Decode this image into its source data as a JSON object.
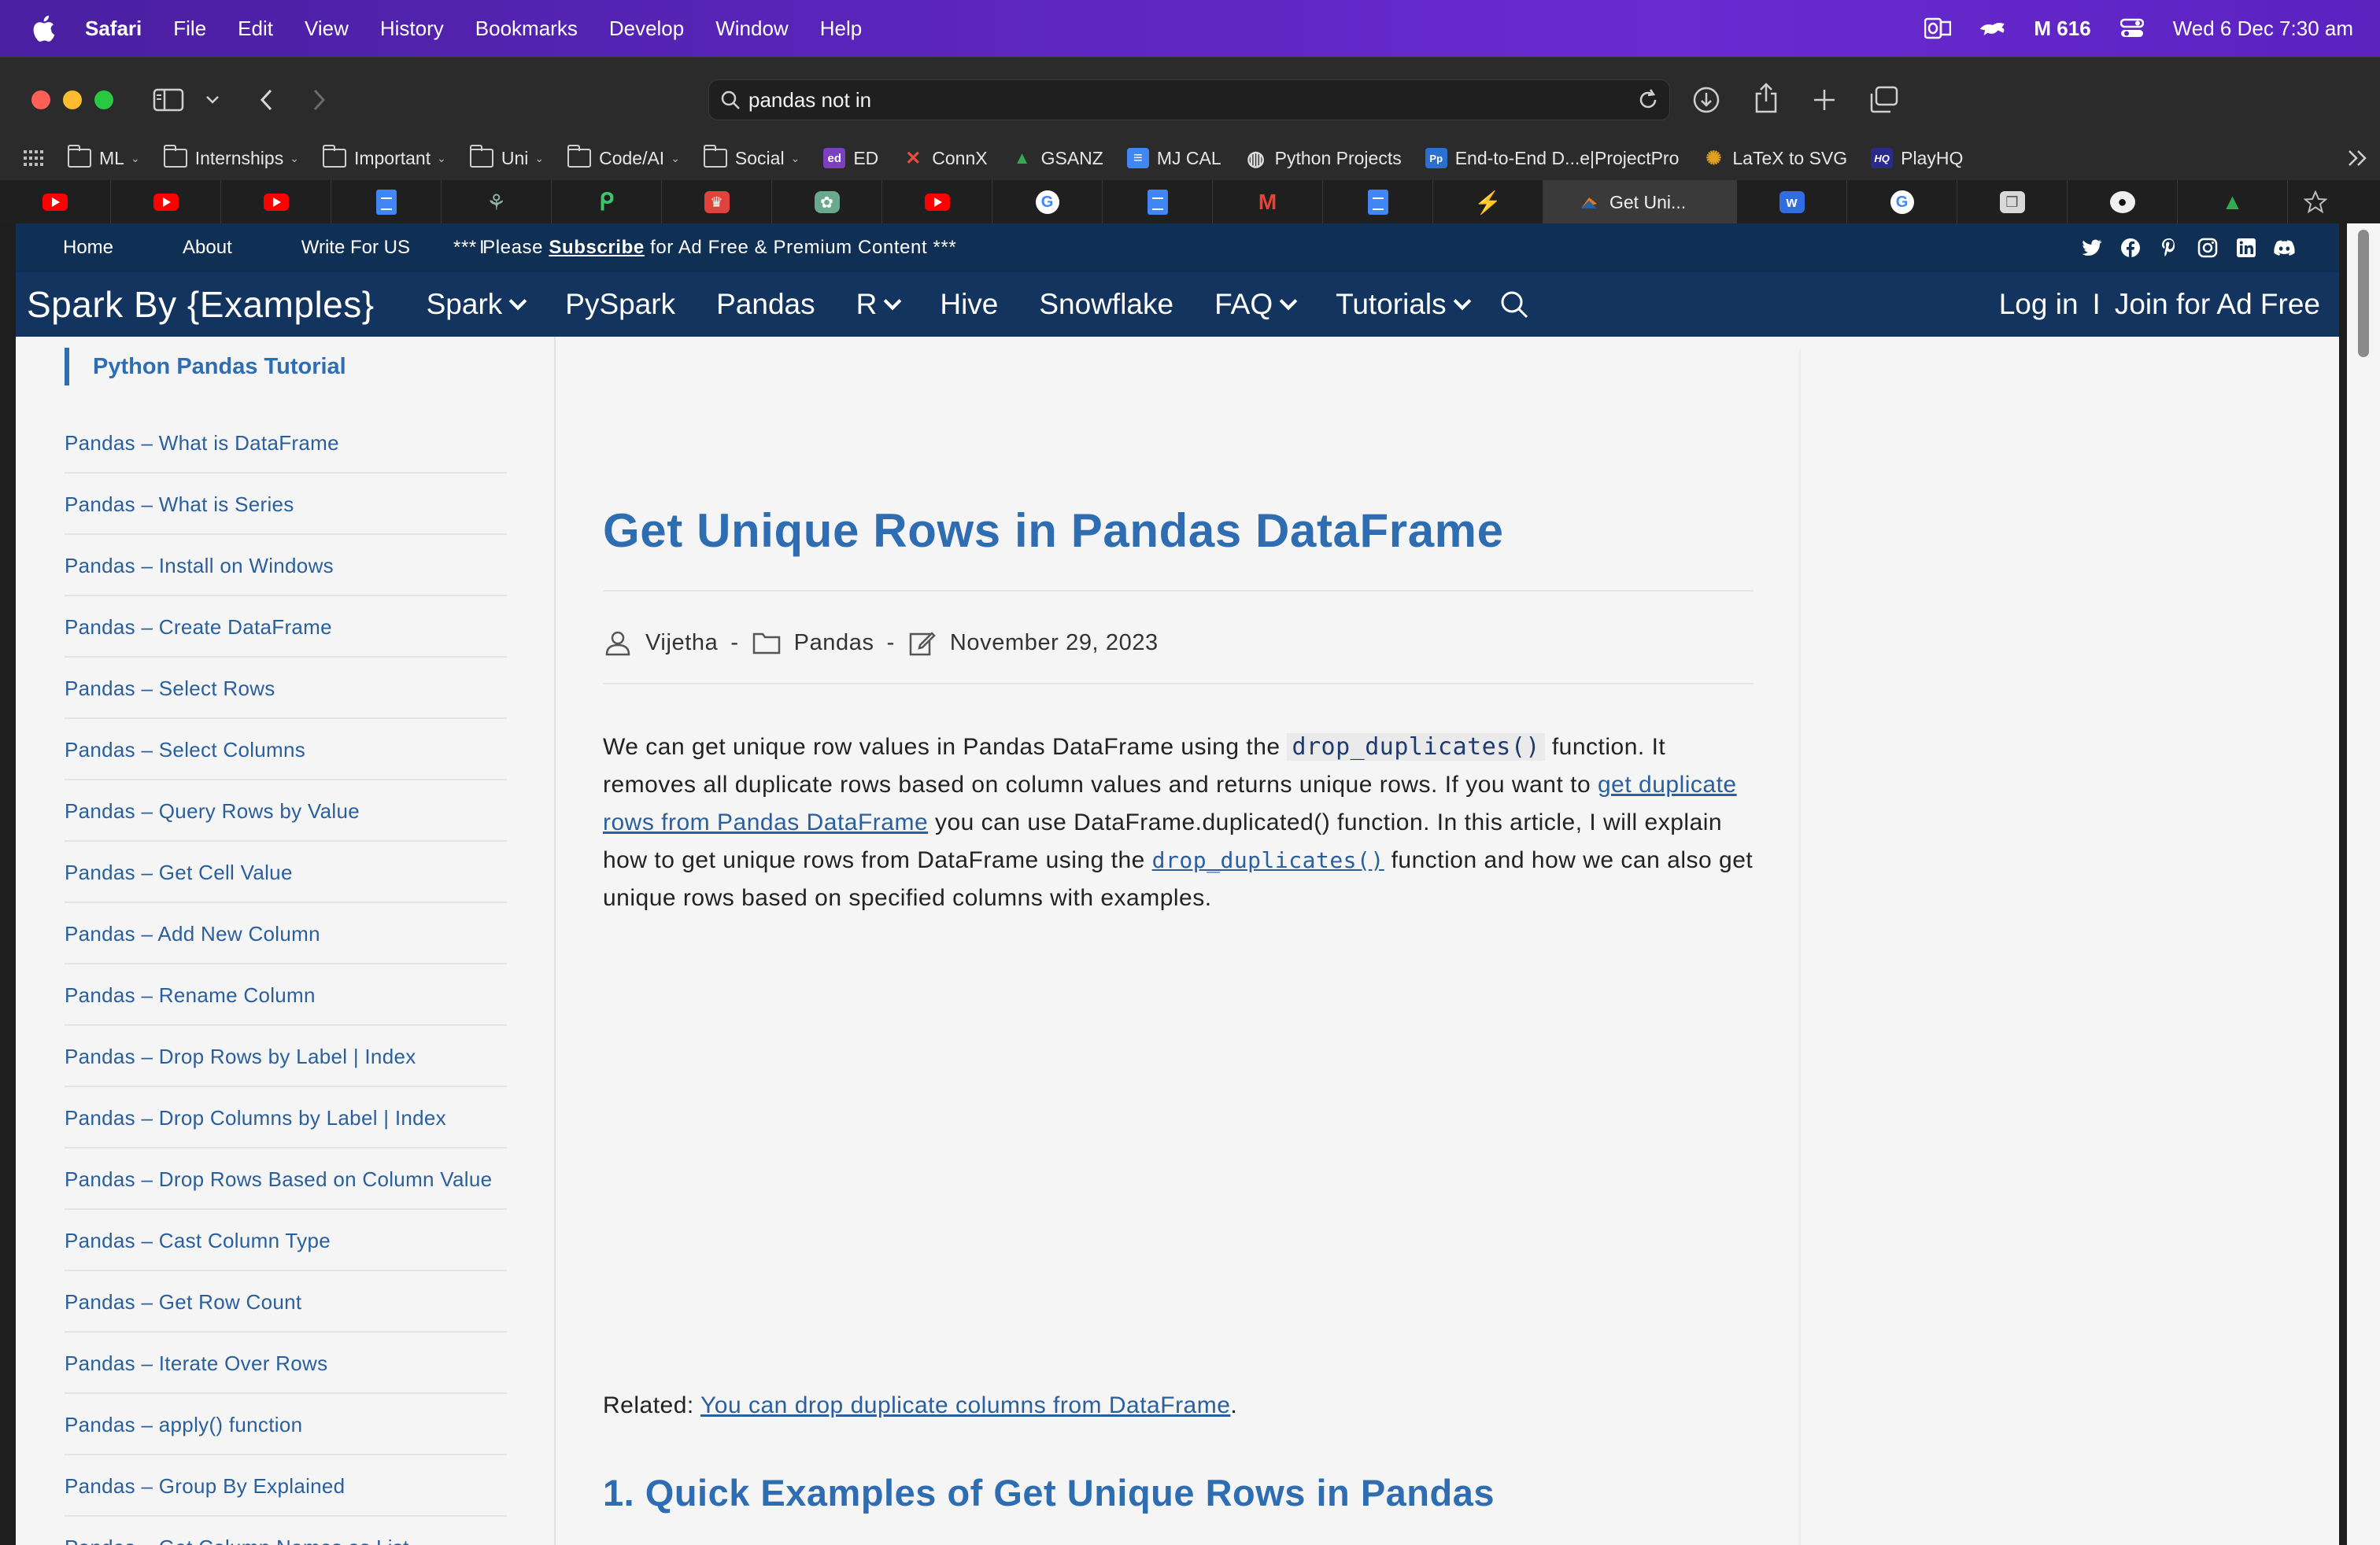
{
  "menubar": {
    "app": "Safari",
    "items": [
      "File",
      "Edit",
      "View",
      "History",
      "Bookmarks",
      "Develop",
      "Window",
      "Help"
    ],
    "status_mail": "M 616",
    "clock": "Wed 6 Dec  7:30 am"
  },
  "browser": {
    "address": "pandas not in",
    "bookmarks": [
      {
        "label": "ML",
        "folder": true
      },
      {
        "label": "Internships",
        "folder": true
      },
      {
        "label": "Important",
        "folder": true
      },
      {
        "label": "Uni",
        "folder": true
      },
      {
        "label": "Code/AI",
        "folder": true
      },
      {
        "label": "Social",
        "folder": true
      },
      {
        "label": "ED",
        "icon_text": "ed",
        "color": "#7b3fbf"
      },
      {
        "label": "ConnX",
        "icon_text": "✕",
        "color": "#c0392b"
      },
      {
        "label": "GSANZ",
        "icon_text": "▲",
        "color": "#34a853"
      },
      {
        "label": "MJ CAL",
        "icon_text": "≡",
        "color": "#4285f4"
      },
      {
        "label": "Python Projects",
        "icon_text": "◍",
        "color": "#666666"
      },
      {
        "label": "End-to-End D...e|ProjectPro",
        "icon_text": "Pp",
        "color": "#2d6fd0"
      },
      {
        "label": "LaTeX to SVG",
        "icon_text": "✺",
        "color": "#e0a020"
      },
      {
        "label": "PlayHQ",
        "icon_text": "HQ",
        "color": "#2a2a8a"
      }
    ],
    "active_tab": "Get Uni..."
  },
  "site": {
    "top_links": [
      "Home",
      "About",
      "Write For US",
      "I"
    ],
    "promo_pre": "*** Please ",
    "promo_link": "Subscribe",
    "promo_post": " for Ad Free & Premium Content ***",
    "brand": "Spark By {Examples}",
    "nav": [
      {
        "label": "Spark",
        "dropdown": true
      },
      {
        "label": "PySpark",
        "dropdown": false
      },
      {
        "label": "Pandas",
        "dropdown": false
      },
      {
        "label": "R",
        "dropdown": true
      },
      {
        "label": "Hive",
        "dropdown": false
      },
      {
        "label": "Snowflake",
        "dropdown": false
      },
      {
        "label": "FAQ",
        "dropdown": true
      },
      {
        "label": "Tutorials",
        "dropdown": true
      }
    ],
    "login": "Log in",
    "auth_sep": "I",
    "join": "Join for Ad Free"
  },
  "sidebar": {
    "title": "Python Pandas Tutorial",
    "items": [
      "Pandas – What is DataFrame",
      "Pandas – What is Series",
      "Pandas – Install on Windows",
      "Pandas – Create DataFrame",
      "Pandas – Select Rows",
      "Pandas – Select Columns",
      "Pandas – Query Rows by Value",
      "Pandas – Get Cell Value",
      "Pandas – Add New Column",
      "Pandas – Rename Column",
      "Pandas – Drop Rows by Label | Index",
      "Pandas – Drop Columns by Label | Index",
      "Pandas – Drop Rows Based on Column Value",
      "Pandas – Cast Column Type",
      "Pandas – Get Row Count",
      "Pandas – Iterate Over Rows",
      "Pandas – apply() function",
      "Pandas – Group By Explained",
      "Pandas – Get Column Names as List"
    ]
  },
  "article": {
    "title": "Get Unique Rows in Pandas DataFrame",
    "author": "Vijetha",
    "category": "Pandas",
    "date": "November 29, 2023",
    "meta_sep": "-",
    "intro": {
      "t1": "We can get unique row values in Pandas DataFrame using the ",
      "code1": "drop_duplicates()",
      "t2": " function. It removes all duplicate rows based on column values and returns unique rows. If you want to ",
      "link1": "get duplicate rows from Pandas DataFrame",
      "t3": " you can use DataFrame.duplicated() function. In this article, I will explain how to get unique rows from DataFrame using the ",
      "link2": "drop_duplicates()",
      "t4": " function and how we can also get unique rows based on specified columns with examples."
    },
    "related_label": "Related: ",
    "related_link": "You can drop duplicate columns from DataFrame",
    "related_end": ".",
    "h2": "1. Quick Examples of Get Unique Rows in Pandas"
  }
}
